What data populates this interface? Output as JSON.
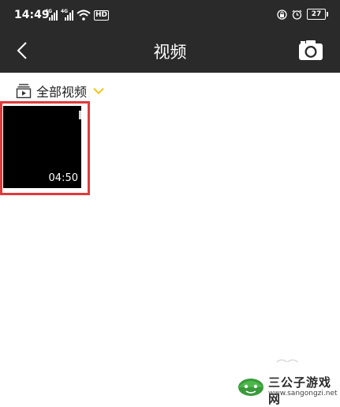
{
  "status_bar": {
    "time": "14:49",
    "signal_tag_1": "4G",
    "signal_tag_2": "4G",
    "network_badge": "HD",
    "battery": "27"
  },
  "header": {
    "title": "视频"
  },
  "album_selector": {
    "label": "全部视频"
  },
  "videos": [
    {
      "duration": "04:50"
    }
  ],
  "watermark": {
    "title": "三公子游戏网",
    "url": "www.sangongzi.net"
  },
  "colors": {
    "bar_background": "#2a2a2a",
    "accent_yellow": "#f5c518",
    "highlight_red": "#e03a3a"
  }
}
